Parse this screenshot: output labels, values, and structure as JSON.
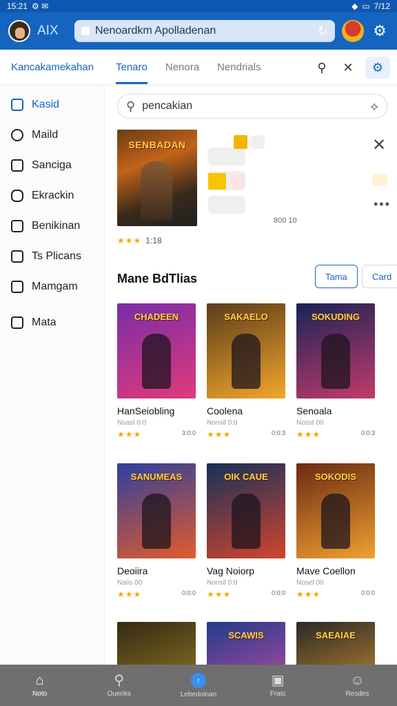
{
  "status_bar": {
    "time": "15:21",
    "left_icons": "⚙ ✉",
    "right_text": "7/12"
  },
  "browser": {
    "brand": "AIX",
    "url": "Nenoardkm Apolladenan"
  },
  "header": {
    "app_title": "Kancakamekahan",
    "tabs": [
      {
        "label": "Tenaro",
        "active": true
      },
      {
        "label": "Nenora",
        "active": false
      },
      {
        "label": "Nendrials",
        "active": false
      }
    ]
  },
  "sidebar": {
    "items": [
      {
        "label": "Kasid",
        "active": true
      },
      {
        "label": "Maild",
        "active": false
      },
      {
        "label": "Sanciga",
        "active": false
      },
      {
        "label": "Ekrackin",
        "active": false
      },
      {
        "label": "Benikinan",
        "active": false
      },
      {
        "label": "Ts Plicans",
        "active": false
      },
      {
        "label": "Mamgam",
        "active": false
      },
      {
        "label": "Mata",
        "active": false
      }
    ]
  },
  "search": {
    "placeholder": "pencakian"
  },
  "featured": {
    "title": "SENBADAN",
    "rating_stars": "★★★",
    "rating_value": "1:18",
    "stat": "800 10"
  },
  "section": {
    "title": "Mane BdTlias",
    "primary_button": "Tama",
    "secondary_button": "Card"
  },
  "games": [
    {
      "name": "HanSeiobling",
      "sub": "Noasl 0:0",
      "stars": "★★★",
      "count": "3:0:0",
      "art": "CHADEEN",
      "c1": "#7a2da8",
      "c2": "#e03a7a"
    },
    {
      "name": "Coolena",
      "sub": "Nonsil 0:0",
      "stars": "★★★",
      "count": "0:0:3",
      "art": "SAKAELO",
      "c1": "#5b3d1b",
      "c2": "#f3a62a"
    },
    {
      "name": "Senoala",
      "sub": "Nosst 00",
      "stars": "★★★",
      "count": "0:0:3",
      "art": "SOKUDING",
      "c1": "#1a2356",
      "c2": "#c23b6b"
    },
    {
      "name": "Deoiira",
      "sub": "Naiis 00",
      "stars": "★★★",
      "count": "0:0:0",
      "art": "SANUMEAS",
      "c1": "#2d3f9e",
      "c2": "#e35b2b"
    },
    {
      "name": "Vag Noiorp",
      "sub": "Nonsil 0:0",
      "stars": "★★★",
      "count": "0:0:0",
      "art": "OIK CAUE",
      "c1": "#16305a",
      "c2": "#d2452d"
    },
    {
      "name": "Mave Coellon",
      "sub": "Nosel 00",
      "stars": "★★★",
      "count": "0:0:0",
      "art": "SOKODIS",
      "c1": "#6a2a12",
      "c2": "#f0a030"
    },
    {
      "name": "",
      "sub": "",
      "stars": "",
      "count": "",
      "art": "",
      "c1": "#352a12",
      "c2": "#a48a2a"
    },
    {
      "name": "",
      "sub": "",
      "stars": "",
      "count": "",
      "art": "SCAWIS",
      "c1": "#233b8a",
      "c2": "#d94fa5"
    },
    {
      "name": "",
      "sub": "",
      "stars": "",
      "count": "",
      "art": "SAEAIAE",
      "c1": "#2a2a2a",
      "c2": "#e09b2a"
    }
  ],
  "bottom_nav": [
    {
      "label": "Noto",
      "icon": "home-icon",
      "glyph": "⌂",
      "active": true
    },
    {
      "label": "Ouenks",
      "icon": "search-icon",
      "glyph": "⚲",
      "active": false
    },
    {
      "label": "Lebedoinan",
      "icon": "fab-icon",
      "glyph": "↑",
      "active": false
    },
    {
      "label": "Fratc",
      "icon": "frame-icon",
      "glyph": "▣",
      "active": false
    },
    {
      "label": "Resdes",
      "icon": "user-icon",
      "glyph": "☺",
      "active": false
    }
  ]
}
